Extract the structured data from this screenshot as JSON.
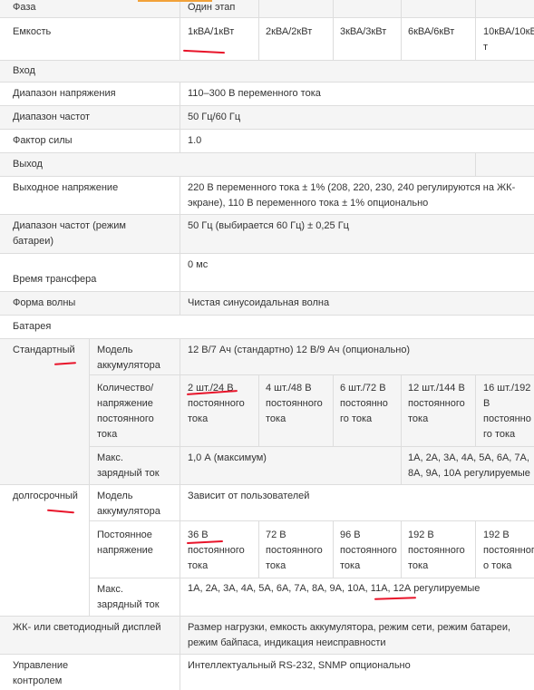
{
  "table": {
    "phase": {
      "label": "Фаза",
      "value": "Один этап"
    },
    "capacity": {
      "label": "Емкость",
      "values": [
        "1кВА/1кВт",
        "2кВА/2кВт",
        "3кВА/3кВт",
        "6кВА/6кВт",
        "10кВА/10кВ\nт"
      ]
    },
    "input_section": "Вход",
    "voltage_range": {
      "label": "Диапазон напряжения",
      "value": "110–300 В переменного тока"
    },
    "freq_range": {
      "label": "Диапазон частот",
      "value": "50 Гц/60 Гц"
    },
    "power_factor": {
      "label": "Фактор силы",
      "value": "1.0"
    },
    "output_section": "Выход",
    "output_voltage": {
      "label": "Выходное напряжение",
      "value": "220 В переменного тока ± 1% (208, 220, 230, 240 регулируются на ЖК-\nэкране), 110 В переменного тока ± 1% опционально"
    },
    "battery_freq": {
      "label": "Диапазон частот (режим\nбатареи)",
      "value": "50 Гц (выбирается 60 Гц) ± 0,25 Гц"
    },
    "transfer_time": {
      "label": "Время трансфера",
      "value": "0 мс"
    },
    "waveform": {
      "label": "Форма волны",
      "value": "Чистая синусоидальная волна"
    },
    "battery_section": "Батарея",
    "standard": {
      "label": "Стандартный",
      "model": {
        "label": "Модель\nаккумулятора",
        "value": "12 В/7 Ач (стандартно) 12 В/9 Ач (опционально)"
      },
      "qty_voltage": {
        "label": "Количество/\nнапряжение\nпостоянного\nтока",
        "values": [
          "2 шт./24 В\nпостоянного\nтока",
          "4 шт./48 В\nпостоянного\nтока",
          "6 шт./72 В\nпостоянно\nго тока",
          "12 шт./144 В\nпостоянного\nтока",
          "16 шт./192\nВ\nпостоянно\nго тока"
        ]
      },
      "max_charge": {
        "label": "Макс.\nзарядный ток",
        "value_small": "1,0 А (максимум)",
        "value_large": "1А, 2А, 3А, 4А, 5А, 6А, 7А,\n8А, 9А, 10А регулируемые"
      }
    },
    "long_term": {
      "label": "долгосрочный",
      "model": {
        "label": "Модель\nаккумулятора",
        "value": "Зависит от пользователей"
      },
      "dc_voltage": {
        "label": "Постоянное\nнапряжение",
        "values": [
          "36 В\nпостоянного\nтока",
          "72 В\nпостоянного\nтока",
          "96 В\nпостоянного\nтока",
          "192 В\nпостоянного\nтока",
          "192 В\nпостоянног\nо тока"
        ]
      },
      "max_charge": {
        "label": "Макс.\nзарядный ток",
        "value": "1А, 2А, 3А, 4А, 5А, 6А, 7А, 8А, 9А, 10А, 11А, 12А регулируемые"
      }
    },
    "display": {
      "label": "ЖК- или светодиодный дисплей",
      "value": "Размер нагрузки, емкость аккумулятора, режим сети, режим батареи,\nрежим байпаса, индикация неисправности"
    },
    "control": {
      "label": "Управление\nконтролем",
      "value": "Интеллектуальный RS-232, SNMP опционально"
    }
  },
  "annotation_color": "#e8142a",
  "accent_color": "#f2a23a"
}
